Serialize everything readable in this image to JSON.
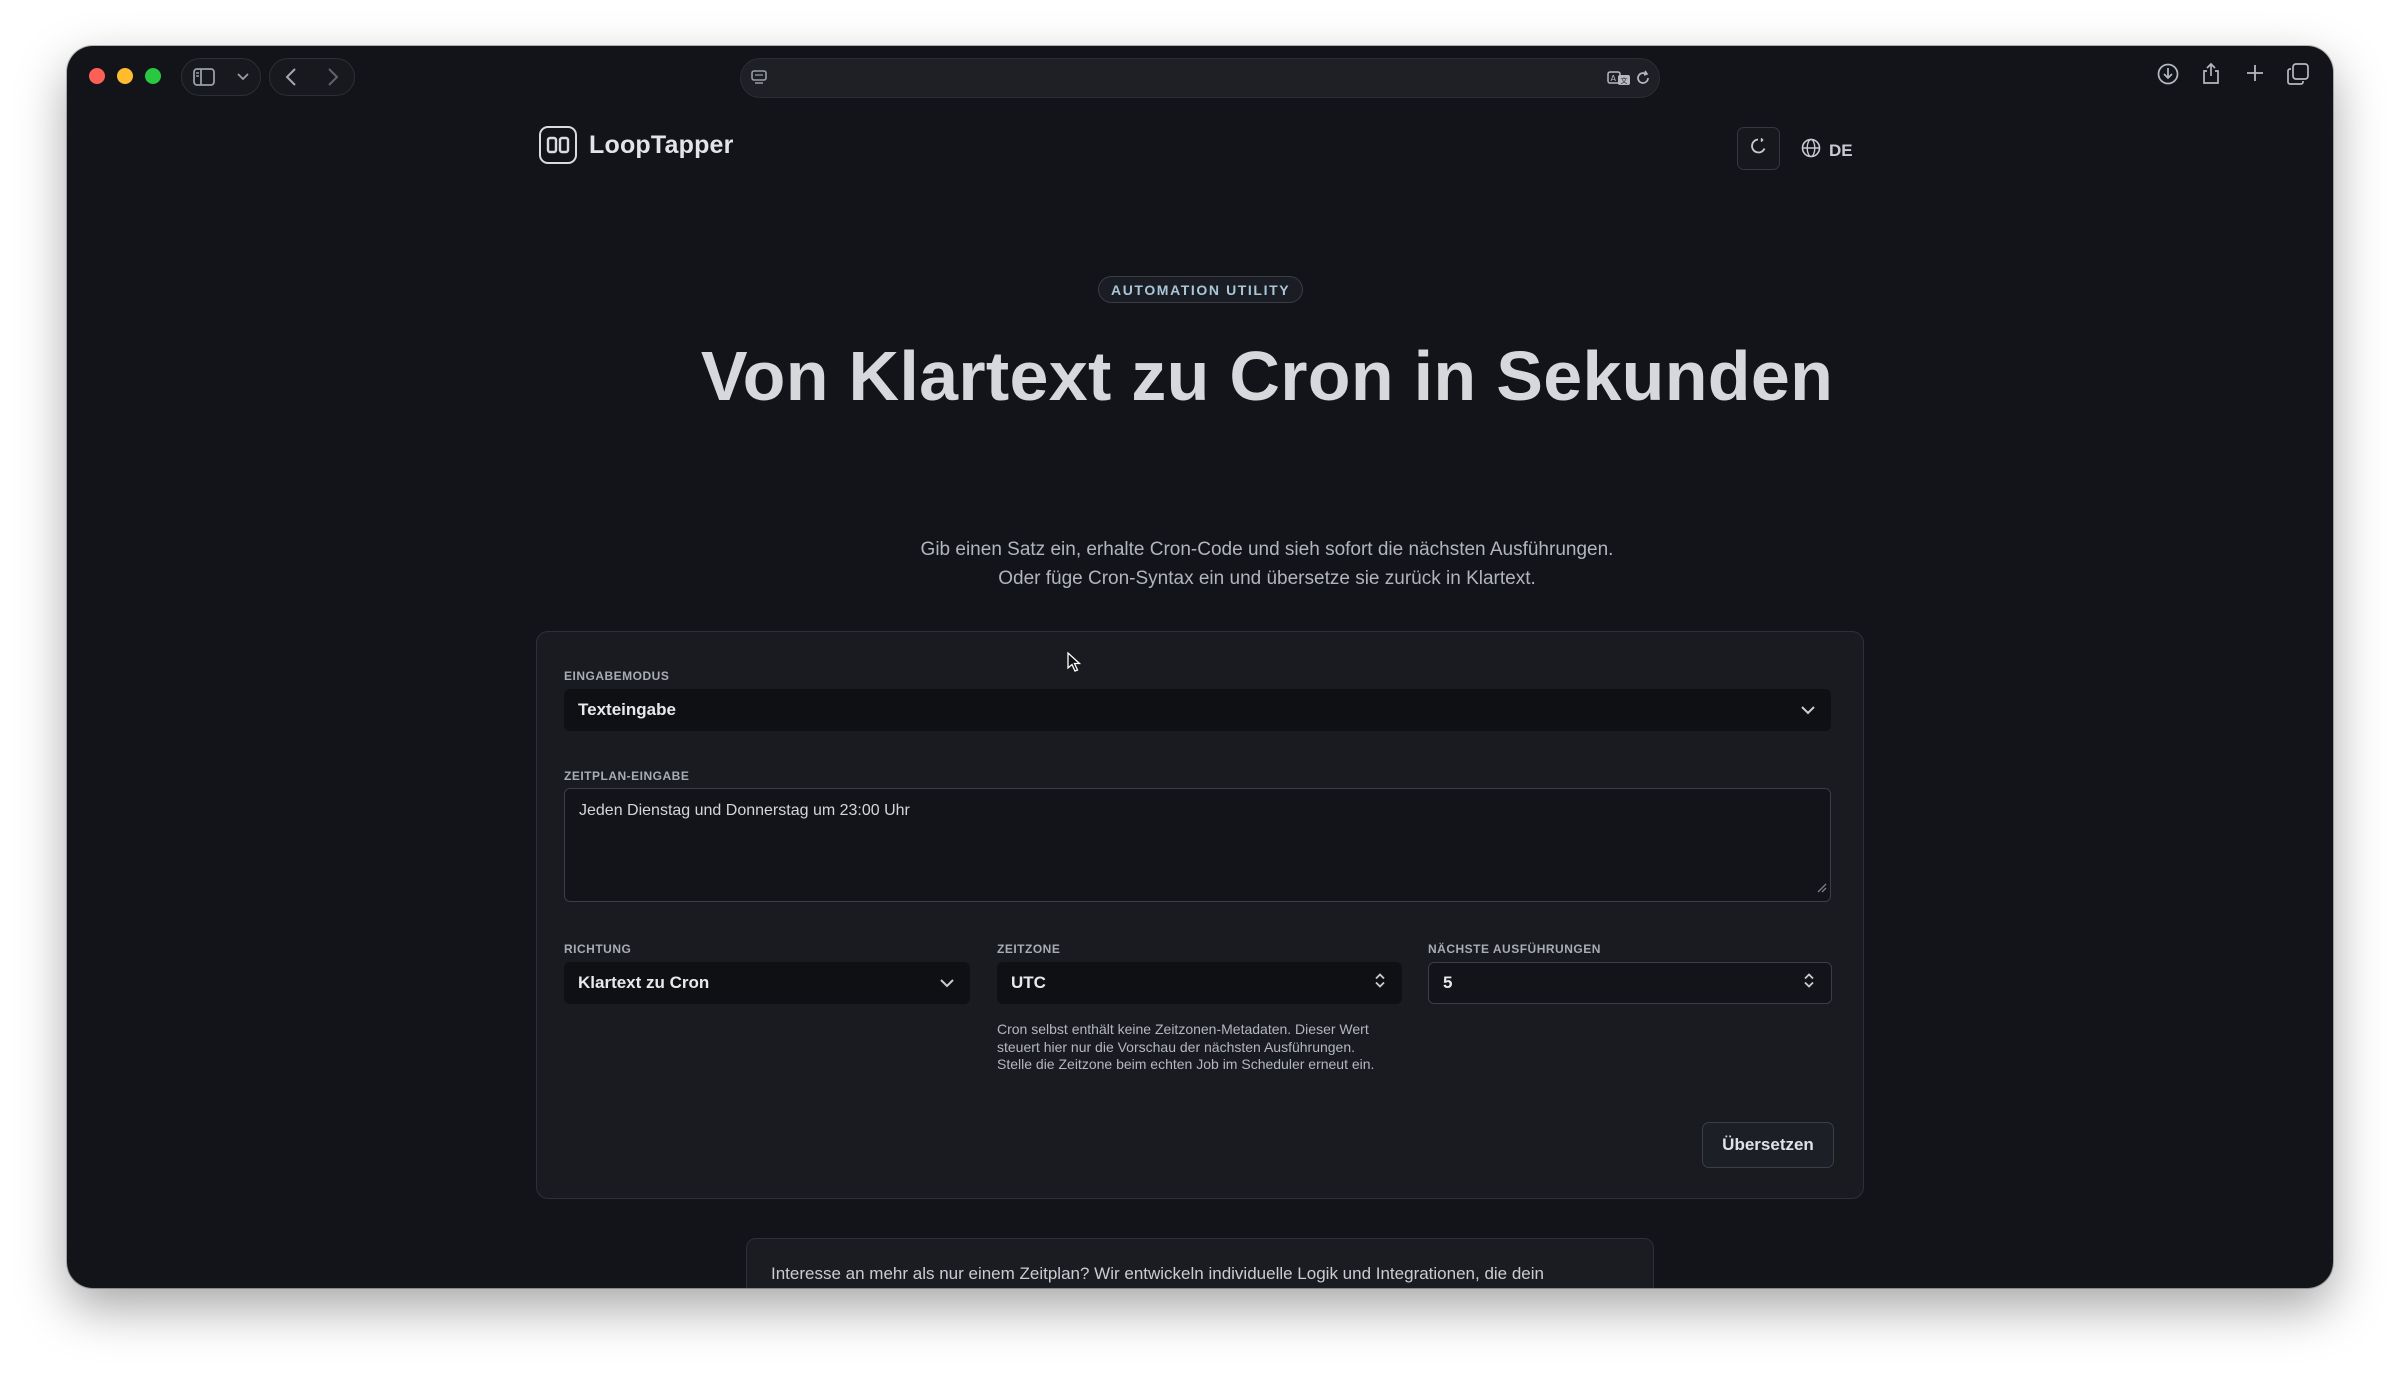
{
  "brand": {
    "name": "LoopTapper"
  },
  "header": {
    "language": "DE"
  },
  "hero": {
    "badge": "AUTOMATION UTILITY",
    "title": "Von Klartext zu Cron in Sekunden",
    "subtitle_line1": "Gib einen Satz ein, erhalte Cron-Code und sieh sofort die nächsten Ausführungen.",
    "subtitle_line2": "Oder füge Cron-Syntax ein und übersetze sie zurück in Klartext."
  },
  "form": {
    "input_mode": {
      "label": "EINGABEMODUS",
      "value": "Texteingabe"
    },
    "schedule": {
      "label": "ZEITPLAN-EINGABE",
      "value": "Jeden Dienstag und Donnerstag um 23:00 Uhr"
    },
    "direction": {
      "label": "RICHTUNG",
      "value": "Klartext zu Cron"
    },
    "timezone": {
      "label": "ZEITZONE",
      "value": "UTC",
      "note": "Cron selbst enthält keine Zeitzonen-Metadaten. Dieser Wert steuert hier nur die Vorschau der nächsten Ausführungen. Stelle die Zeitzone beim echten Job im Scheduler erneut ein."
    },
    "next_runs": {
      "label": "NÄCHSTE AUSFÜHRUNGEN",
      "value": "5"
    },
    "submit_label": "Übersetzen"
  },
  "promo": {
    "text": "Interesse an mehr als nur einem Zeitplan? Wir entwickeln individuelle Logik und Integrationen, die dein"
  },
  "colors": {
    "background": "#121419",
    "card": "#191b21",
    "field": "#0f1014",
    "accent_badge": "#a9c6d9"
  }
}
